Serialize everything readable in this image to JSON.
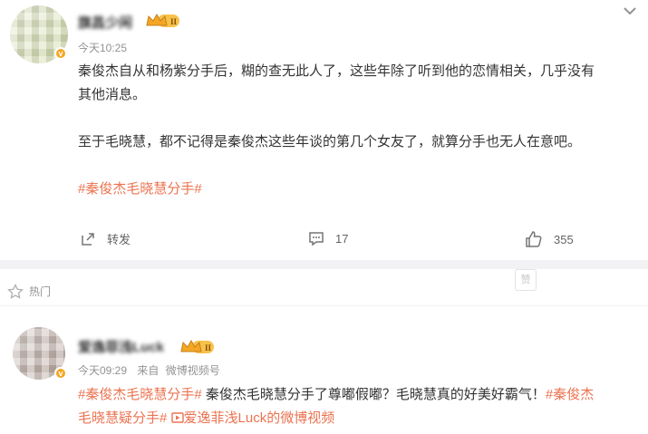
{
  "post1": {
    "author_name": "旗昌少闲",
    "level_badge": "II",
    "time": "今天10:25",
    "content_line1": "秦俊杰自从和杨紫分手后，糊的查无此人了，这些年除了听到他的恋情相关，几乎没有",
    "content_line2": "其他消息。",
    "content_para2": "至于毛晓慧，都不记得是秦俊杰这些年谈的第几个女友了，就算分手也无人在意吧。",
    "hashtag": "#秦俊杰毛晓慧分手#",
    "repost_label": "转发",
    "comment_count": "17",
    "like_count": "355"
  },
  "mini_tag": "赞",
  "hot_section": {
    "label": "热门"
  },
  "post2": {
    "author_name": "爱逸菲浅Luck",
    "level_badge": "II",
    "time": "今天09:29",
    "source_prefix": "来自",
    "source": "微博视频号",
    "hashtag1": "#秦俊杰毛晓慧分手#",
    "text1": " 秦俊杰毛晓慧分手了尊嘟假嘟？毛晓慧真的好美好霸气！",
    "hashtag2a": "#秦俊杰",
    "hashtag2b": "毛晓慧疑分手#",
    "video_link": "爱逸菲浅Luck的微博视频"
  },
  "colors": {
    "accent": "#eb7350",
    "muted": "#939393",
    "text": "#333333"
  }
}
